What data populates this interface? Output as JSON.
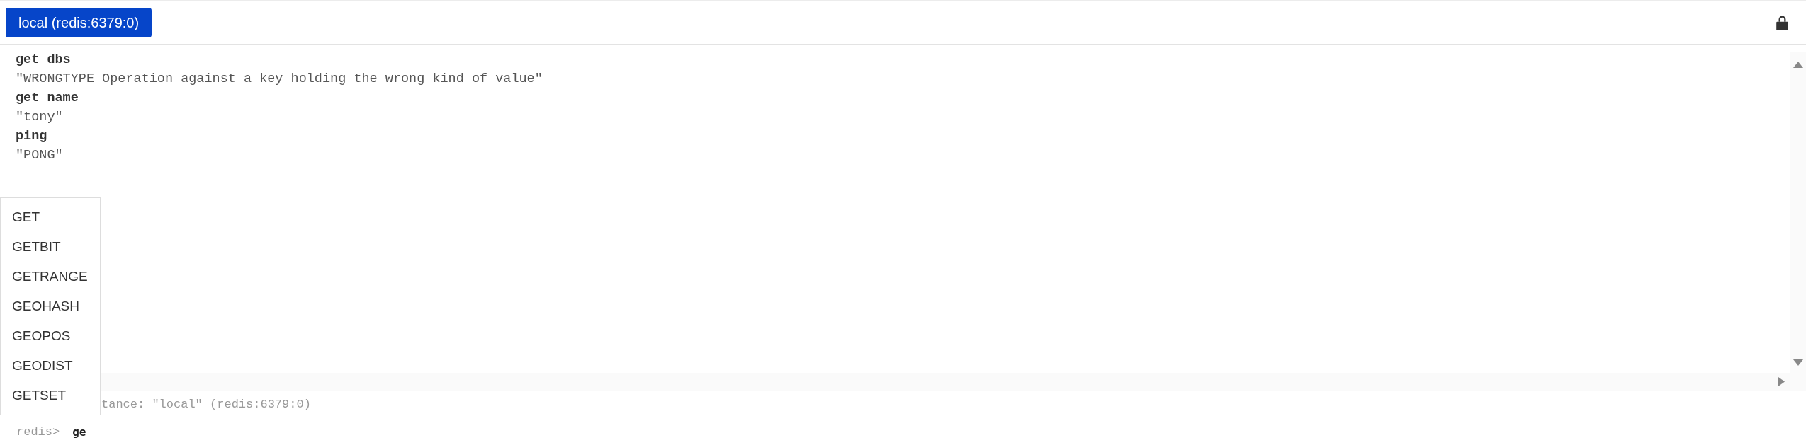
{
  "connection_button": "local (redis:6379:0)",
  "console_lines": [
    {
      "kind": "command",
      "text": "get dbs"
    },
    {
      "kind": "output",
      "text": "\"WRONGTYPE Operation against a key holding the wrong kind of value\""
    },
    {
      "kind": "command",
      "text": "get name"
    },
    {
      "kind": "output",
      "text": "\"tony\""
    },
    {
      "kind": "command",
      "text": "ping"
    },
    {
      "kind": "output",
      "text": "\"PONG\""
    }
  ],
  "info_line": "tance: \"local\" (redis:6379:0)",
  "prompt": {
    "label": "redis>",
    "value": "ge"
  },
  "autocomplete": [
    "GET",
    "GETBIT",
    "GETRANGE",
    "GEOHASH",
    "GEOPOS",
    "GEODIST",
    "GETSET"
  ]
}
